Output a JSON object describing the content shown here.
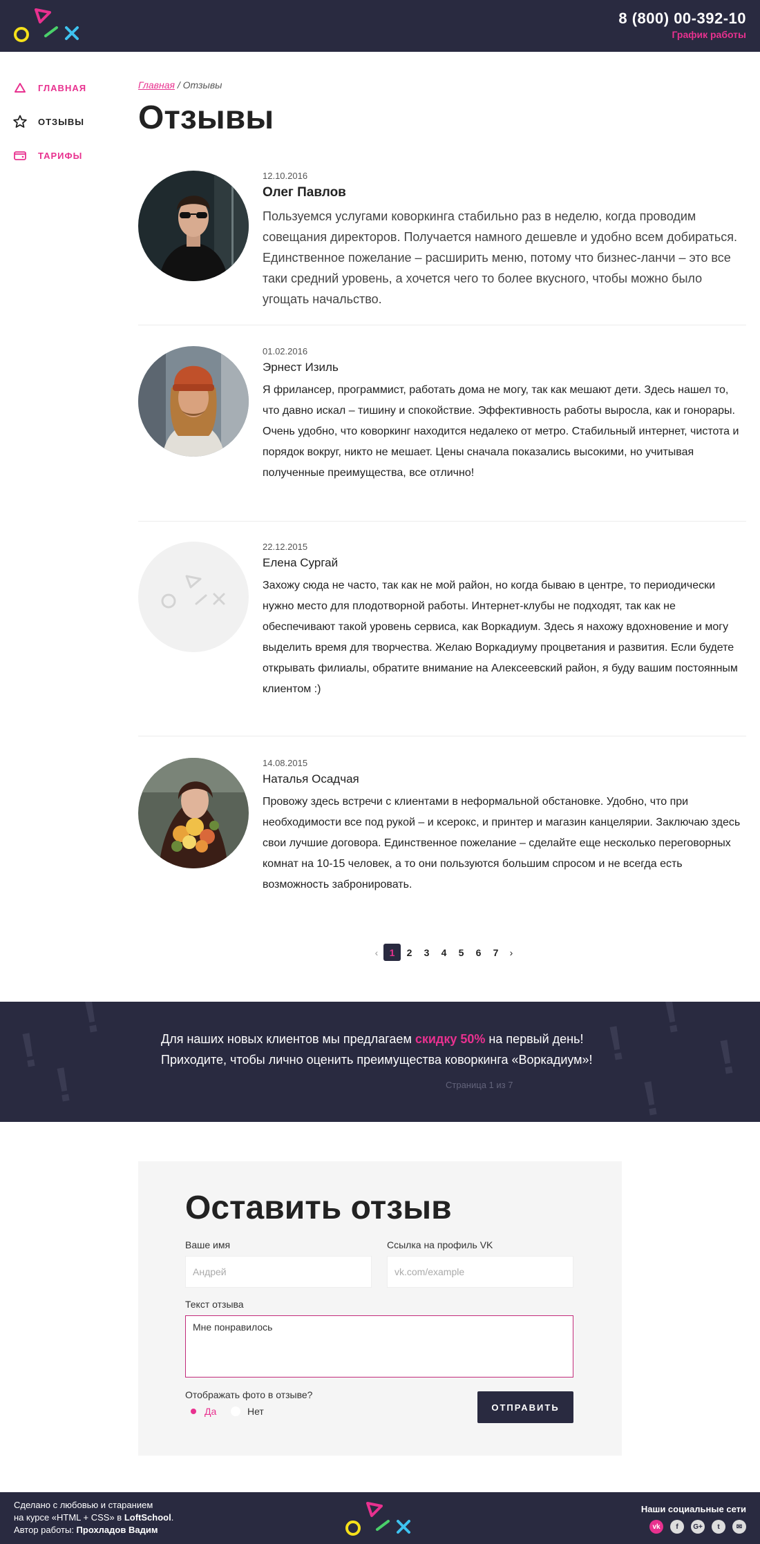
{
  "header": {
    "phone": "8 (800) 00-392-10",
    "hours_link": "График работы"
  },
  "nav": {
    "items": [
      {
        "label": "Главная",
        "icon": "triangle-icon"
      },
      {
        "label": "Отзывы",
        "icon": "star-icon"
      },
      {
        "label": "Тарифы",
        "icon": "wallet-icon"
      }
    ]
  },
  "breadcrumb": {
    "home": "Главная",
    "separator": "/",
    "current": "Отзывы"
  },
  "page_title": "Отзывы",
  "reviews": [
    {
      "date": "12.10.2016",
      "name": "Олег Павлов",
      "text": "Пользуемся услугами коворкинга стабильно раз в неделю, когда проводим совещания директоров. Получается намного дешевле и удобно всем добираться. Единственное пожелание – расширить меню, потому что бизнес-ланчи – это все таки средний уровень, а хочется чего то более вкусного, чтобы можно было угощать начальство."
    },
    {
      "date": "01.02.2016",
      "name": "Эрнест Изиль",
      "text": "Я фрилансер, программист, работать дома не могу, так как мешают дети. Здесь нашел то, что давно искал – тишину и спокойствие. Эффективность работы выросла, как и гонорары. Очень удобно, что коворкинг находится недалеко от метро. Стабильный интернет, чистота и порядок вокруг, никто не мешает. Цены сначала показались высокими, но учитывая полученные преимущества, все отлично!"
    },
    {
      "date": "22.12.2015",
      "name": "Елена Сургай",
      "text": "Захожу сюда не часто, так как не мой район, но когда бываю в центре, то периодически нужно место для плодотворной работы. Интернет-клубы не подходят, так как не обеспечивают такой уровень сервиса, как Воркадиум. Здесь я нахожу вдохновение и могу выделить время для творчества. Желаю Воркадиуму процветания и развития. Если будете открывать филиалы, обратите внимание на Алексеевский район, я буду вашим постоянным клиентом :)"
    },
    {
      "date": "14.08.2015",
      "name": "Наталья Осадчая",
      "text": "Провожу здесь встречи с клиентами в неформальной обстановке. Удобно, что при необходимости все под рукой – и ксерокс, и принтер и магазин канцелярии. Заключаю здесь свои лучшие договора. Единственное пожелание – сделайте еще несколько переговорных комнат на 10-15 человек, а то они пользуются большим спросом и не всегда есть возможность забронировать."
    }
  ],
  "pagination": {
    "prev": "‹",
    "next": "›",
    "pages": [
      "1",
      "2",
      "3",
      "4",
      "5",
      "6",
      "7"
    ],
    "current": "1"
  },
  "promo": {
    "text_before": "Для наших новых клиентов мы предлагаем ",
    "highlight": "скидку 50%",
    "text_after": " на первый день! Приходите, чтобы лично оценить преимущества коворкинга «Воркадиум»!",
    "page_info": "Страница 1 из 7"
  },
  "form": {
    "title": "Оставить отзыв",
    "name_label": "Ваше имя",
    "name_placeholder": "Андрей",
    "vk_label": "Ссылка на профиль VK",
    "vk_placeholder": "vk.com/example",
    "text_label": "Текст отзыва",
    "text_value": "Мне понравилось",
    "photo_question": "Отображать фото в отзыве?",
    "yes_label": "Да",
    "no_label": "Нет",
    "submit_label": "ОТПРАВИТЬ"
  },
  "footer": {
    "line1": "Сделано с любовью и старанием",
    "line2_before": "на курсе «HTML + CSS» в ",
    "line2_brand": "LoftSchool",
    "line2_after": ".",
    "line3_before": "Автор работы: ",
    "line3_author": "Прохладов Вадим",
    "social_title": "Наши социальные сети",
    "social": [
      {
        "icon": "vk-icon",
        "glyph": "vk"
      },
      {
        "icon": "facebook-icon",
        "glyph": "f"
      },
      {
        "icon": "google-plus-icon",
        "glyph": "G+"
      },
      {
        "icon": "twitter-icon",
        "glyph": "t"
      },
      {
        "icon": "email-icon",
        "glyph": "✉"
      }
    ]
  },
  "colors": {
    "dark": "#292a40",
    "accent": "#e8318f",
    "yellow": "#f5e01a",
    "green": "#4ad06a",
    "blue": "#3ec3f0"
  }
}
